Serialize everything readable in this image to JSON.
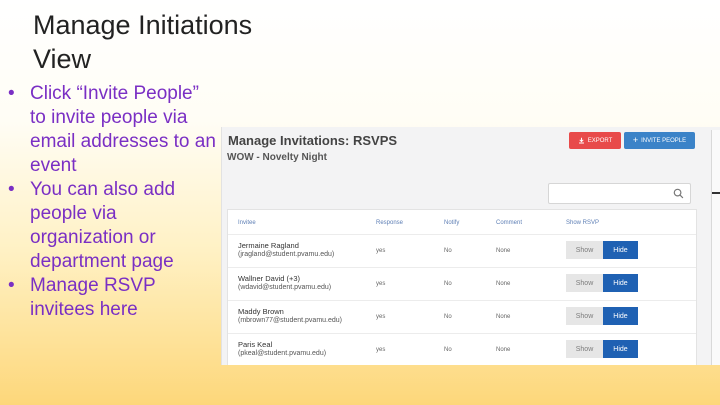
{
  "slide": {
    "title_line1": "Manage Initiations",
    "title_line2": "View",
    "bullets": [
      "Click “Invite People” to invite people via email addresses to an event",
      "You can also add people via organization or department page",
      "Manage RSVP invitees here"
    ]
  },
  "screenshot": {
    "title": "Manage Invitations: RSVPS",
    "event_name": "WOW - Novelty Night",
    "export_label": "EXPORT",
    "invite_label": "INVITE PEOPLE",
    "search_placeholder": "",
    "columns": [
      "Invitee",
      "Response",
      "Notify",
      "Comment",
      "Show RSVP"
    ],
    "show_label": "Show",
    "hide_label": "Hide",
    "rows": [
      {
        "name": "Jermaine Ragland",
        "email": "(jragland@student.pvamu.edu)",
        "response": "yes",
        "notify": "No",
        "comment": "None"
      },
      {
        "name": "Wallner David (+3)",
        "email": "(wdavid@student.pvamu.edu)",
        "response": "yes",
        "notify": "No",
        "comment": "None"
      },
      {
        "name": "Maddy Brown",
        "email": "(mbrown77@student.pvamu.edu)",
        "response": "yes",
        "notify": "No",
        "comment": "None"
      },
      {
        "name": "Paris Keal",
        "email": "(pkeal@student.pvamu.edu)",
        "response": "yes",
        "notify": "No",
        "comment": "None"
      }
    ],
    "colors": {
      "export": "#e84a4a",
      "invite": "#3b83c8",
      "hide": "#1f61b3",
      "bullet_text": "#7a2fc4"
    }
  }
}
